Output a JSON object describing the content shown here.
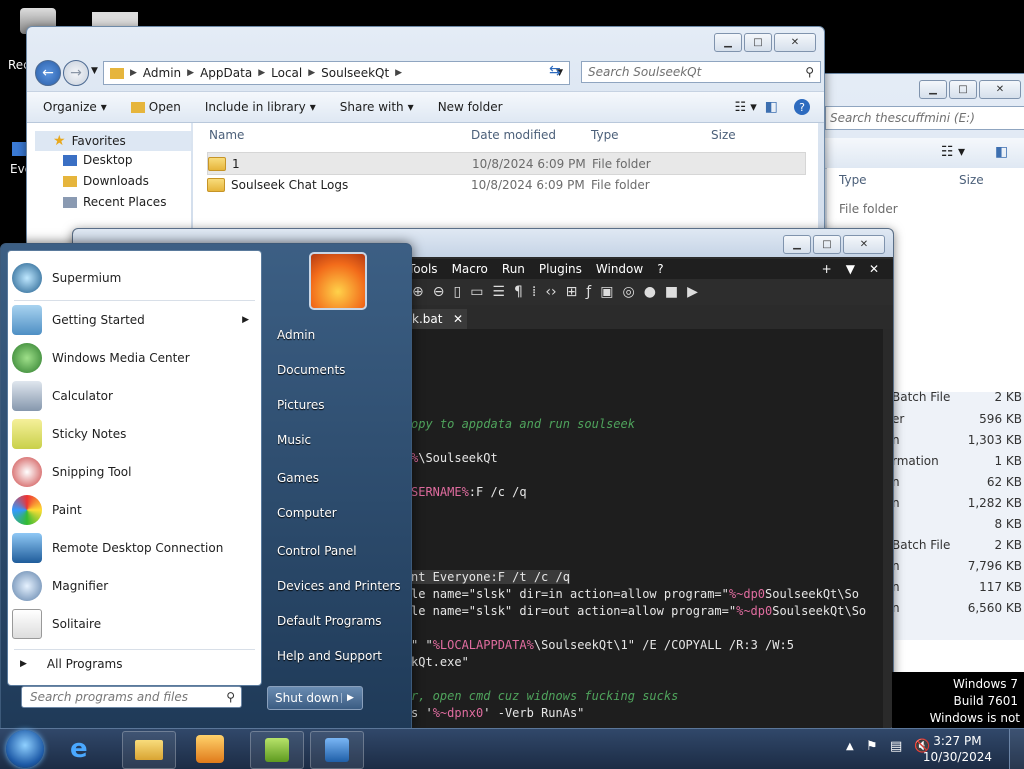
{
  "desktop": {
    "icons": [
      "Rec",
      "Eve"
    ]
  },
  "explorer": {
    "breadcrumb": [
      "Admin",
      "AppData",
      "Local",
      "SoulseekQt"
    ],
    "search_placeholder": "Search SoulseekQt",
    "toolbar": {
      "organize": "Organize",
      "open": "Open",
      "include": "Include in library",
      "share": "Share with",
      "new_folder": "New folder"
    },
    "nav": {
      "favorites": "Favorites",
      "items": [
        "Desktop",
        "Downloads",
        "Recent Places"
      ]
    },
    "columns": {
      "name": "Name",
      "date": "Date modified",
      "type": "Type",
      "size": "Size"
    },
    "files": [
      {
        "name": "1",
        "date": "10/8/2024 6:09 PM",
        "type": "File folder"
      },
      {
        "name": "Soulseek Chat Logs",
        "date": "10/8/2024 6:09 PM",
        "type": "File folder"
      }
    ]
  },
  "explorer2": {
    "search_placeholder": "Search thescuffmini (E:)",
    "col_type": "Type",
    "col_size": "Size",
    "type_first": "File folder",
    "rows": [
      {
        "type": "Batch File",
        "size": "2 KB"
      },
      {
        "type": "er",
        "size": "596 KB"
      },
      {
        "type": "n",
        "size": "1,303 KB"
      },
      {
        "type": "rmation",
        "size": "1 KB"
      },
      {
        "type": "n",
        "size": "62 KB"
      },
      {
        "type": "n",
        "size": "1,282 KB"
      },
      {
        "type": "",
        "size": "8 KB"
      },
      {
        "type": "Batch File",
        "size": "2 KB"
      },
      {
        "type": "n",
        "size": "7,796 KB"
      },
      {
        "type": "n",
        "size": "117 KB"
      },
      {
        "type": "n",
        "size": "6,560 KB"
      }
    ]
  },
  "npp": {
    "menu": [
      "Tools",
      "Macro",
      "Run",
      "Plugins",
      "Window",
      "?"
    ],
    "menu_extra": [
      "+",
      "▼",
      "✕"
    ],
    "tab_label": "k.bat",
    "lines": {
      "l1": "opy to appdata and run soulseek",
      "l2_a": "%",
      "l2_b": "\\SoulseekQt",
      "l3_a": "SERNAME%",
      "l3_b": ":F /c /q",
      "l4": "nt Everyone:F /t /c /q",
      "l5_a": "le name=\"slsk\" dir=in action=allow program=\"",
      "l5_b": "%~dp0",
      "l5_c": "SoulseekQt\\So",
      "l6_a": "le name=\"slsk\" dir=out action=allow program=\"",
      "l6_b": "%~dp0",
      "l6_c": "SoulseekQt\\So",
      "l7_a": "\" \"",
      "l7_b": "%LOCALAPPDATA%",
      "l7_c": "\\SoulseekQt\\1\" /E /COPYALL /R:3 /W:5",
      "l8": "kQt.exe\"",
      "l9": "r, open cmd cuz widnows fucking sucks",
      "l10_a": "s '",
      "l10_b": "%~dpnx0",
      "l10_c": "' -Verb RunAs\""
    }
  },
  "startmenu": {
    "programs": [
      "Supermium",
      "Getting Started",
      "Windows Media Center",
      "Calculator",
      "Sticky Notes",
      "Snipping Tool",
      "Paint",
      "Remote Desktop Connection",
      "Magnifier",
      "Solitaire"
    ],
    "all_programs": "All Programs",
    "search_placeholder": "Search programs and files",
    "right": [
      "Admin",
      "Documents",
      "Pictures",
      "Music",
      "Games",
      "Computer",
      "Control Panel",
      "Devices and Printers",
      "Default Programs",
      "Help and Support"
    ],
    "shutdown": "Shut down"
  },
  "watermark": {
    "line1": "Windows 7",
    "line2": "Build 7601",
    "line3": "Windows is not genuine"
  },
  "tray": {
    "time": "3:27 PM",
    "date": "10/30/2024"
  },
  "colors": {
    "accent": "#3c5f84",
    "taskbar": "#1c2c45",
    "editor_bg": "#1e1e1e"
  }
}
